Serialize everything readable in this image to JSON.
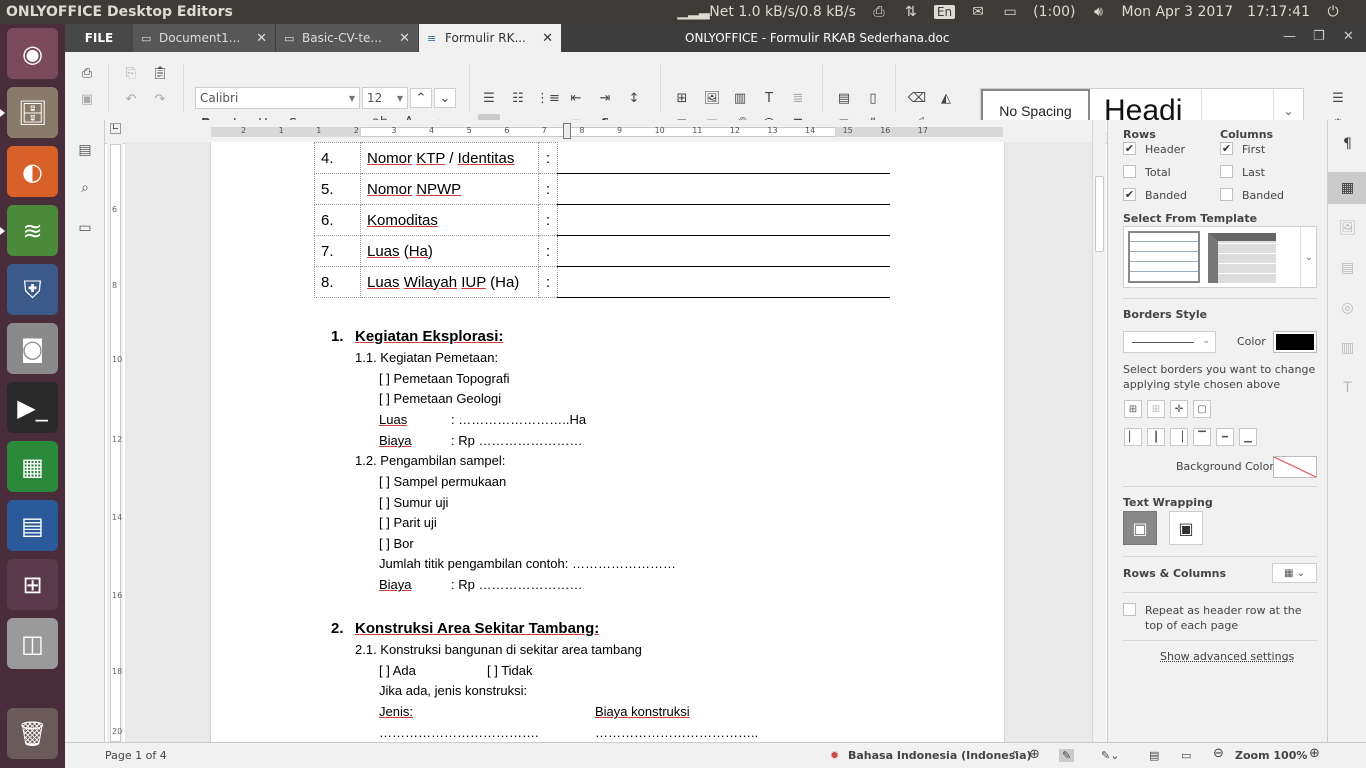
{
  "top_panel": {
    "app_title": "ONLYOFFICE Desktop Editors",
    "net": "Net 1.0 kB/s/0.8 kB/s",
    "lang": "En",
    "battery": "(1:00)",
    "date": "Mon Apr  3 2017",
    "time": "17:17:41"
  },
  "tabs": {
    "file_label": "FILE",
    "docs": [
      {
        "label": "Document1..."
      },
      {
        "label": "Basic-CV-te..."
      },
      {
        "label": "Formulir RK..."
      }
    ],
    "window_title": "ONLYOFFICE - Formulir RKAB Sederhana.doc"
  },
  "toolbar": {
    "font_name": "Calibri",
    "font_size": "12",
    "style_no_spacing": "No Spacing",
    "style_heading": "Headi"
  },
  "ruler": {
    "h_numbers": [
      "2",
      "1",
      "1",
      "2",
      "3",
      "4",
      "5",
      "6",
      "7",
      "8",
      "9",
      "10",
      "11",
      "12",
      "13",
      "14",
      "15",
      "16",
      "17"
    ]
  },
  "document": {
    "table_rows": [
      {
        "num": "4.",
        "label_parts": [
          "Nomor",
          " ",
          "KTP",
          " / ",
          "Identitas"
        ],
        "colon": ":"
      },
      {
        "num": "5.",
        "label_parts": [
          "Nomor",
          " ",
          "NPWP"
        ],
        "colon": ":"
      },
      {
        "num": "6.",
        "label_parts": [
          "Komoditas"
        ],
        "colon": ":"
      },
      {
        "num": "7.",
        "label_parts": [
          "Luas",
          " (",
          "Ha",
          ")"
        ],
        "colon": ":"
      },
      {
        "num": "8.",
        "label_parts": [
          "Luas",
          " ",
          "Wilayah",
          " ",
          "IUP",
          " (Ha)"
        ],
        "colon": ":"
      }
    ],
    "section1": {
      "num": "1.",
      "title": "Kegiatan Eksplorasi:",
      "sub1": "1.1. Kegiatan Pemetaan:",
      "sub1_items": [
        "[    ] Pemetaan Topografi",
        "[    ] Pemetaan Geologi"
      ],
      "luas": "Luas",
      "luas_val": ": ……………………..Ha",
      "biaya": "Biaya",
      "biaya_val": ": Rp ……………………",
      "sub2": "1.2. Pengambilan sampel:",
      "sub2_items": [
        "[    ] Sampel permukaan",
        "[    ] Sumur uji",
        "[    ] Parit uji",
        "[    ] Bor"
      ],
      "jumlah": "Jumlah titik pengambilan contoh: ……………………",
      "biaya2": "Biaya",
      "biaya2_val": ": Rp ……………………"
    },
    "section2": {
      "num": "2.",
      "title": "Konstruksi Area Sekitar Tambang:",
      "sub1": "2.1.  Konstruksi bangunan di sekitar area tambang",
      "ada": "[    ] Ada",
      "tidak": "[    ] Tidak",
      "jika": "Jika ada, jenis konstruksi:",
      "jenis": "Jenis:",
      "biaya_kons": "Biaya konstruksi",
      "dots1": "……………………………….",
      "dots2": "……………………………….."
    }
  },
  "right_panel": {
    "rows_label": "Rows",
    "columns_label": "Columns",
    "header": "Header",
    "total": "Total",
    "banded": "Banded",
    "first": "First",
    "last": "Last",
    "banded_col": "Banded",
    "checks": {
      "header": true,
      "total": false,
      "banded": true,
      "first": true,
      "last": false,
      "banded_col": false
    },
    "select_template": "Select From Template",
    "borders_style": "Borders Style",
    "color": "Color",
    "border_color": "#000000",
    "select_borders_hint": "Select borders you want to change applying style chosen above",
    "background_color": "Background Color",
    "text_wrapping": "Text Wrapping",
    "rows_columns": "Rows & Columns",
    "repeat_header": "Repeat as header row at the top of each page",
    "advanced": "Show advanced settings"
  },
  "status": {
    "page": "Page 1 of 4",
    "language": "Bahasa Indonesia (Indonesia)",
    "zoom": "Zoom 100%"
  }
}
